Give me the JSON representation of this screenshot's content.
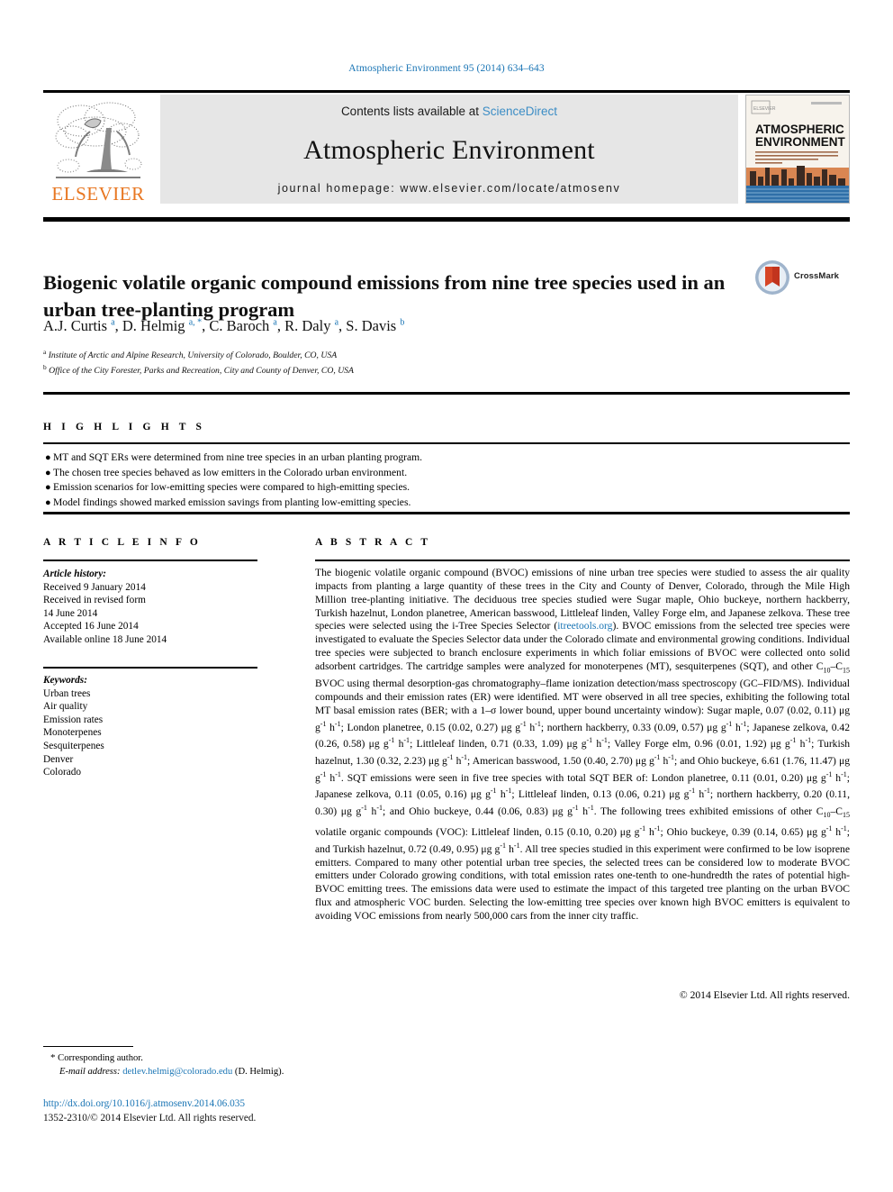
{
  "running_head": "Atmospheric Environment 95 (2014) 634–643",
  "banner": {
    "publisher": "ELSEVIER",
    "contents_prefix": "Contents lists available at ",
    "contents_link": "ScienceDirect",
    "journal_name": "Atmospheric Environment",
    "homepage": "journal homepage: www.elsevier.com/locate/atmosenv",
    "cover_title_line1": "ATMOSPHERIC",
    "cover_title_line2": "ENVIRONMENT"
  },
  "article": {
    "title": "Biogenic volatile organic compound emissions from nine tree species used in an urban tree-planting program",
    "crossmark_label": "CrossMark",
    "authors_html": "A.J. Curtis <sup>a</sup>, D. Helmig <sup>a, *</sup>, C. Baroch <sup>a</sup>, R. Daly <sup>a</sup>, S. Davis <sup>b</sup>",
    "affiliations": [
      {
        "mark": "a",
        "text": "Institute of Arctic and Alpine Research, University of Colorado, Boulder, CO, USA"
      },
      {
        "mark": "b",
        "text": "Office of the City Forester, Parks and Recreation, City and County of Denver, CO, USA"
      }
    ]
  },
  "highlights": {
    "heading": "H I G H L I G H T S",
    "bullet": "●",
    "items": [
      "MT and SQT ERs were determined from nine tree species in an urban planting program.",
      "The chosen tree species behaved as low emitters in the Colorado urban environment.",
      "Emission scenarios for low-emitting species were compared to high-emitting species.",
      "Model findings showed marked emission savings from planting low-emitting species."
    ]
  },
  "article_info": {
    "heading": "A R T I C L E   I N F O",
    "history_label": "Article history:",
    "history_lines": [
      "Received 9 January 2014",
      "Received in revised form",
      "14 June 2014",
      "Accepted 16 June 2014",
      "Available online 18 June 2014"
    ],
    "keywords_label": "Keywords:",
    "keywords": [
      "Urban trees",
      "Air quality",
      "Emission rates",
      "Monoterpenes",
      "Sesquiterpenes",
      "Denver",
      "Colorado"
    ]
  },
  "abstract": {
    "heading": "A B S T R A C T",
    "link_text": "itreetools.org",
    "part1": "The biogenic volatile organic compound (BVOC) emissions of nine urban tree species were studied to assess the air quality impacts from planting a large quantity of these trees in the City and County of Denver, Colorado, through the Mile High Million tree-planting initiative. The deciduous tree species studied were Sugar maple, Ohio buckeye, northern hackberry, Turkish hazelnut, London planetree, American basswood, Littleleaf linden, Valley Forge elm, and Japanese zelkova. These tree species were selected using the i-Tree Species Selector (",
    "part2": "). BVOC emissions from the selected tree species were investigated to evaluate the Species Selector data under the Colorado climate and environmental growing conditions. Individual tree species were subjected to branch enclosure experiments in which foliar emissions of BVOC were collected onto solid adsorbent cartridges. The cartridge samples were analyzed for monoterpenes (MT), sesquiterpenes (SQT), and other C",
    "sub1": "10",
    "dash1": "–C",
    "sub2": "15",
    "part3": " BVOC using thermal desorption-gas chromatography–flame ionization detection/mass spectroscopy (GC–FID/MS). Individual compounds and their emission rates (ER) were identified. MT were observed in all tree species, exhibiting the following total MT basal emission rates (BER; with a 1–σ lower bound, upper bound uncertainty window): Sugar maple, 0.07 (0.02, 0.11) μg g",
    "part4": "; London planetree, 0.15 (0.02, 0.27) μg g",
    "part5": "; northern hackberry, 0.33 (0.09, 0.57) μg g",
    "part6": "; Japanese zelkova, 0.42 (0.26, 0.58) μg g",
    "part7": "; Littleleaf linden, 0.71 (0.33, 1.09) μg g",
    "part8": "; Valley Forge elm, 0.96 (0.01, 1.92) μg g",
    "part9": "; Turkish hazelnut, 1.30 (0.32, 2.23) μg g",
    "part10": "; American basswood, 1.50 (0.40, 2.70) μg g",
    "part11": "; and Ohio buckeye, 6.61 (1.76, 11.47) μg g",
    "part12": ". SQT emissions were seen in five tree species with total SQT BER of: London planetree, 0.11 (0.01, 0.20) μg g",
    "part13": "; Japanese zelkova, 0.11 (0.05, 0.16) μg g",
    "part14": "; Littleleaf linden, 0.13 (0.06, 0.21) μg g",
    "part15": "; northern hackberry, 0.20 (0.11, 0.30) μg g",
    "part16": "; and Ohio buckeye, 0.44 (0.06, 0.83) μg g",
    "part17": ". The following trees exhibited emissions of other C",
    "part18": " volatile organic compounds (VOC): Littleleaf linden, 0.15 (0.10, 0.20) μg g",
    "part19": "; Ohio buckeye, 0.39 (0.14, 0.65) μg g",
    "part20": "; and Turkish hazelnut, 0.72 (0.49, 0.95) μg g",
    "part21": ". All tree species studied in this experiment were confirmed to be low isoprene emitters. Compared to many other potential urban tree species, the selected trees can be considered low to moderate BVOC emitters under Colorado growing conditions, with total emission rates one-tenth to one-hundredth the rates of potential high-BVOC emitting trees. The emissions data were used to estimate the impact of this targeted tree planting on the urban BVOC flux and atmospheric VOC burden. Selecting the low-emitting tree species over known high BVOC emitters is equivalent to avoiding VOC emissions from nearly 500,000 cars from the inner city traffic.",
    "unit_sup_g": "-1",
    "unit_h": " h",
    "unit_sup_h": "-1",
    "copyright": "© 2014 Elsevier Ltd. All rights reserved."
  },
  "footer": {
    "corresponding_star": "*",
    "corresponding_text": "Corresponding author.",
    "email_label": "E-mail address:",
    "email": "detlev.helmig@colorado.edu",
    "email_suffix": " (D. Helmig).",
    "doi": "http://dx.doi.org/10.1016/j.atmosenv.2014.06.035",
    "issn": "1352-2310/© 2014 Elsevier Ltd. All rights reserved."
  },
  "colors": {
    "link": "#1a75b5",
    "elsevier_orange": "#e87722",
    "banner_grey": "#e6e6e6"
  }
}
